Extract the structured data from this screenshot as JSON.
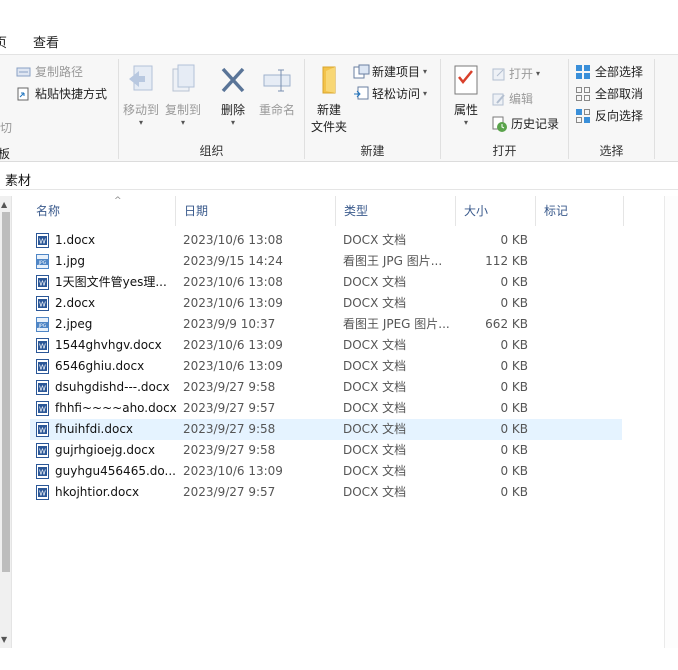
{
  "tabs": {
    "cut_tab": "页",
    "view_tab": "查看"
  },
  "ribbon": {
    "clipboard": {
      "copy_path": "复制路径",
      "paste_shortcut": "粘贴快捷方式",
      "cut_partial": "切",
      "title_partial": "板"
    },
    "organize": {
      "move_to": "移动到",
      "copy_to": "复制到",
      "delete": "删除",
      "rename": "重命名",
      "title": "组织"
    },
    "new": {
      "new_folder_line1": "新建",
      "new_folder_line2": "文件夹",
      "new_item": "新建项目",
      "easy_access": "轻松访问",
      "title": "新建"
    },
    "open": {
      "properties": "属性",
      "open": "打开",
      "edit": "编辑",
      "history": "历史记录",
      "title": "打开"
    },
    "select": {
      "select_all": "全部选择",
      "select_none": "全部取消",
      "invert": "反向选择",
      "title": "选择"
    }
  },
  "address": {
    "current_folder": "素材"
  },
  "columns": {
    "name": "名称",
    "date": "日期",
    "type": "类型",
    "size": "大小",
    "tags": "标记"
  },
  "files": [
    {
      "name": "1.docx",
      "date": "2023/10/6 13:08",
      "type": "DOCX 文档",
      "size": "0 KB",
      "icon": "word-doc-icon"
    },
    {
      "name": "1.jpg",
      "date": "2023/9/15 14:24",
      "type": "看图王 JPG 图片...",
      "size": "112 KB",
      "icon": "jpg-image-icon"
    },
    {
      "name": "1天图文件管yes理...",
      "date": "2023/10/6 13:08",
      "type": "DOCX 文档",
      "size": "0 KB",
      "icon": "word-doc-icon"
    },
    {
      "name": "2.docx",
      "date": "2023/10/6 13:09",
      "type": "DOCX 文档",
      "size": "0 KB",
      "icon": "word-doc-icon"
    },
    {
      "name": "2.jpeg",
      "date": "2023/9/9 10:37",
      "type": "看图王 JPEG 图片...",
      "size": "662 KB",
      "icon": "jpg-image-icon"
    },
    {
      "name": "1544ghvhgv.docx",
      "date": "2023/10/6 13:09",
      "type": "DOCX 文档",
      "size": "0 KB",
      "icon": "word-doc-icon"
    },
    {
      "name": "6546ghiu.docx",
      "date": "2023/10/6 13:09",
      "type": "DOCX 文档",
      "size": "0 KB",
      "icon": "word-doc-icon"
    },
    {
      "name": "dsuhgdishd---.docx",
      "date": "2023/9/27 9:58",
      "type": "DOCX 文档",
      "size": "0 KB",
      "icon": "word-doc-icon"
    },
    {
      "name": "fhhfi~~~~aho.docx",
      "date": "2023/9/27 9:57",
      "type": "DOCX 文档",
      "size": "0 KB",
      "icon": "word-doc-icon"
    },
    {
      "name": "fhuihfdi.docx",
      "date": "2023/9/27 9:58",
      "type": "DOCX 文档",
      "size": "0 KB",
      "icon": "word-doc-icon",
      "selected": true
    },
    {
      "name": "gujrhgioejg.docx",
      "date": "2023/9/27 9:58",
      "type": "DOCX 文档",
      "size": "0 KB",
      "icon": "word-doc-icon"
    },
    {
      "name": "guyhgu456465.do...",
      "date": "2023/10/6 13:09",
      "type": "DOCX 文档",
      "size": "0 KB",
      "icon": "word-doc-icon"
    },
    {
      "name": "hkojhtior.docx",
      "date": "2023/9/27 9:57",
      "type": "DOCX 文档",
      "size": "0 KB",
      "icon": "word-doc-icon"
    }
  ],
  "colors": {
    "selection": "#e5f3ff",
    "header_text": "#3a5a8c",
    "word_blue": "#2b5797",
    "accent": "#1e73be"
  }
}
